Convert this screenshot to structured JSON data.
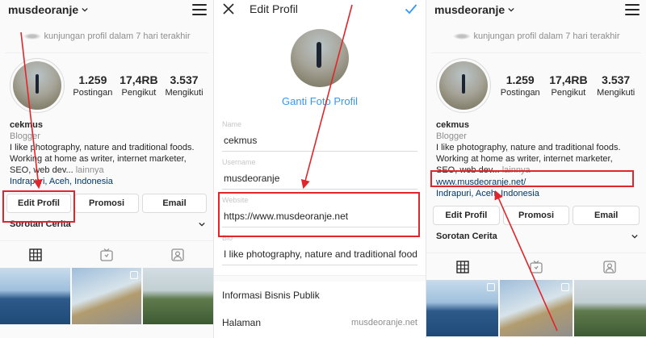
{
  "left": {
    "username": "musdeoranje",
    "visits_text": "kunjungan profil dalam 7 hari terakhir",
    "stats": [
      {
        "num": "1.259",
        "label": "Postingan"
      },
      {
        "num": "17,4RB",
        "label": "Pengikut"
      },
      {
        "num": "3.537",
        "label": "Mengikuti"
      }
    ],
    "bio": {
      "name": "cekmus",
      "category": "Blogger",
      "line1": "I like photography, nature and traditional foods.",
      "line2": "Working at home as writer, internet marketer,",
      "line3": "SEO, web dev...",
      "more": " lainnya",
      "location": "Indrapuri, Aceh, Indonesia"
    },
    "buttons": [
      "Edit Profil",
      "Promosi",
      "Email"
    ],
    "highlights_label": "Sorotan Cerita"
  },
  "middle": {
    "title": "Edit Profil",
    "change_photo": "Ganti Foto Profil",
    "fields": [
      {
        "label": "Name",
        "value": "cekmus"
      },
      {
        "label": "Username",
        "value": "musdeoranje"
      },
      {
        "label": "Website",
        "value": "https://www.musdeoranje.net"
      },
      {
        "label": "Bio",
        "value": "I like photography, nature and traditional foods"
      }
    ],
    "business_info": "Informasi Bisnis Publik",
    "page_label": "Halaman",
    "page_value": "musdeoranje.net"
  },
  "right": {
    "username": "musdeoranje",
    "visits_text": "kunjungan profil dalam 7 hari terakhir",
    "stats": [
      {
        "num": "1.259",
        "label": "Postingan"
      },
      {
        "num": "17,4RB",
        "label": "Pengikut"
      },
      {
        "num": "3.537",
        "label": "Mengikuti"
      }
    ],
    "bio": {
      "name": "cekmus",
      "category": "Blogger",
      "line1": "I like photography, nature and traditional foods.",
      "line2": "Working at home as writer, internet marketer,",
      "line3": "SEO, web dev...",
      "more": " lainnya",
      "website": "www.musdeoranje.net/",
      "location": "Indrapuri, Aceh, Indonesia"
    },
    "buttons": [
      "Edit Profil",
      "Promosi",
      "Email"
    ],
    "highlights_label": "Sorotan Cerita"
  },
  "colors": {
    "annotation": "#e0262b",
    "link_blue": "#3897f0",
    "bio_link": "#00376b"
  }
}
